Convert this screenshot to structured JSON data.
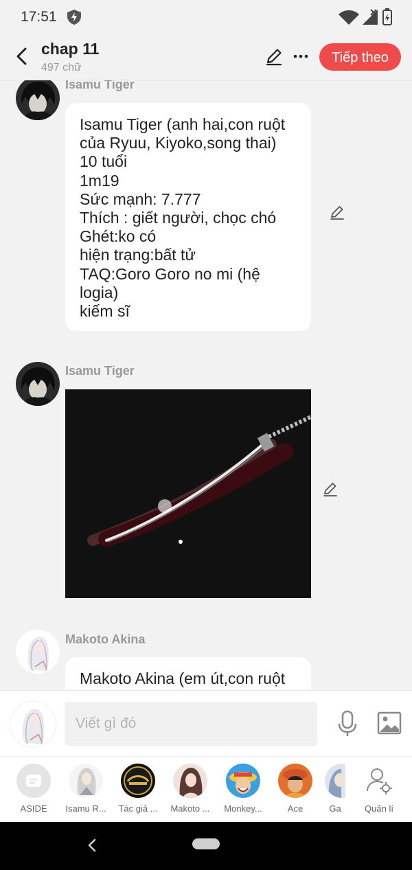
{
  "status_bar": {
    "time": "17:51"
  },
  "header": {
    "title": "chap 11",
    "subtitle": "497 chữ",
    "next_label": "Tiếp theo"
  },
  "messages": [
    {
      "author": "Isamu Tiger",
      "text": "Isamu Tiger (anh hai,con ruột của Ryuu, Kiyoko,song thai)\n10 tuổi\n1m19\nSức mạnh: 7.777\nThích : giết người, chọc chó\nGhét:ko có\nhiện trạng:bất tử\nTAQ:Goro Goro no mi (hệ logia)\nkiếm sĩ"
    },
    {
      "author": "Isamu Tiger",
      "image": "katana photo"
    },
    {
      "author": "Makoto Akina",
      "text": "Makoto Akina (em út,con ruột"
    }
  ],
  "composer": {
    "placeholder": "Viết gì đó"
  },
  "characters": [
    {
      "label": "ASIDE"
    },
    {
      "label": "Isamu R..."
    },
    {
      "label": "Tác giả ..."
    },
    {
      "label": "Makoto ..."
    },
    {
      "label": "Monkey..."
    },
    {
      "label": "Ace"
    },
    {
      "label": "Ga"
    },
    {
      "label": "Quản lí"
    }
  ],
  "colors": {
    "accent": "#ef4b4b",
    "background": "#f2f2f2"
  }
}
